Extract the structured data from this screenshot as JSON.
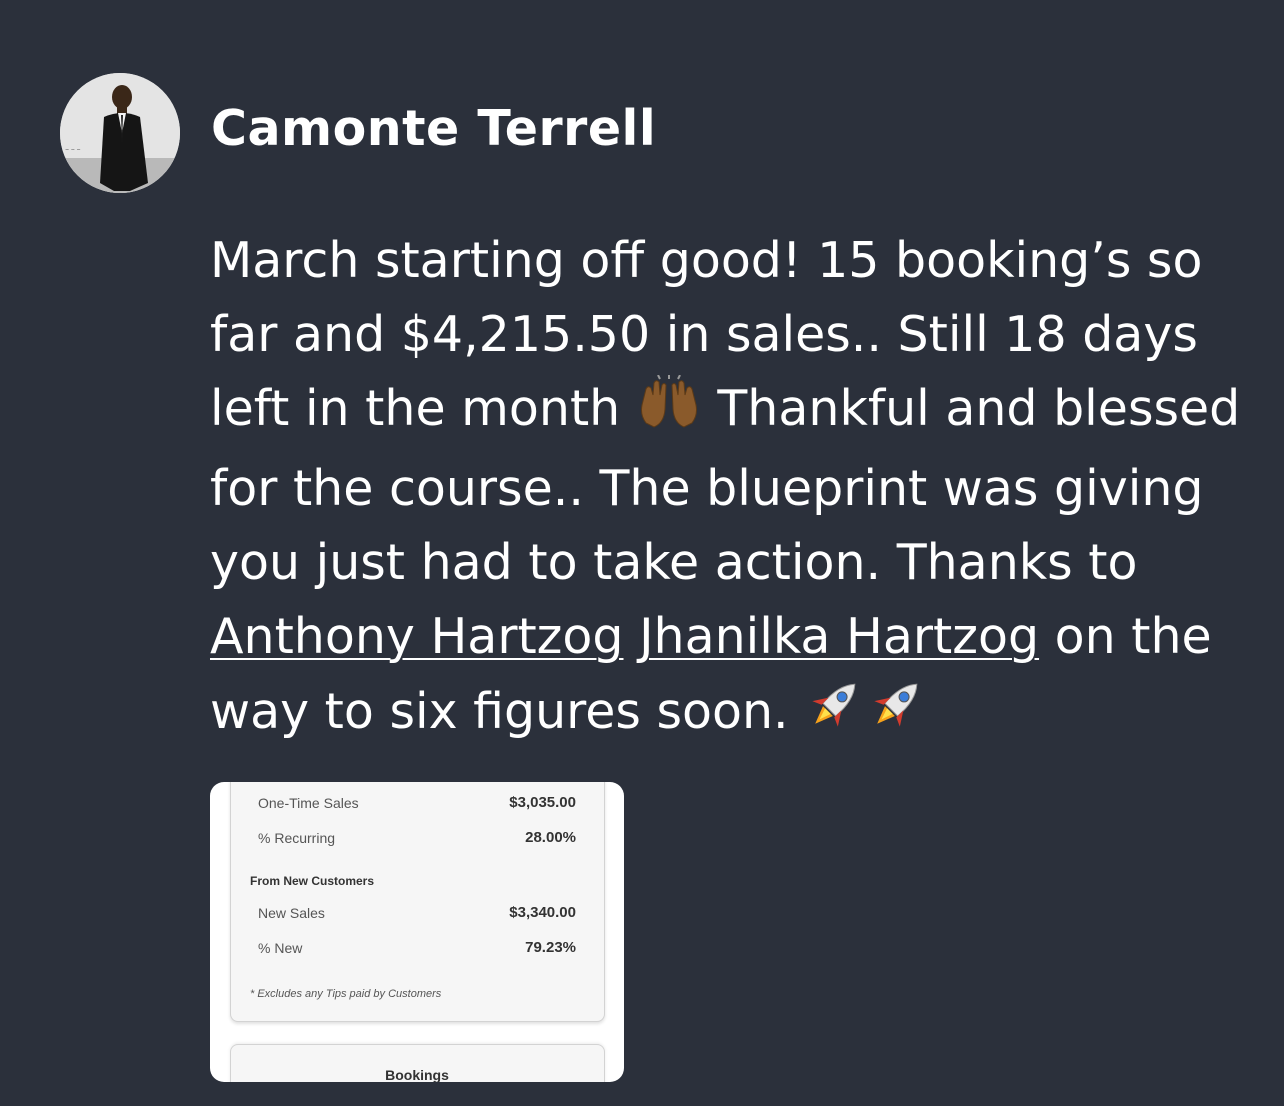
{
  "post": {
    "author": "Camonte Terrell",
    "text": {
      "line1": "March starting off good! 15 booking’s so",
      "line2": "far and $4,215.50 in sales.. Still 18 days",
      "line3a": "left in the month ",
      "line3b": " Thankful and blessed",
      "line4": "for the course.. The blueprint was giving",
      "line5": "you just had to take action. Thanks to",
      "line6_mention1": "Anthony Hartzog",
      "line6_mention2": "Jhanilka Hartzog",
      "line6_rest": " on the",
      "line7": "way to six figures soon. "
    },
    "emojis": [
      "raising-hands-emoji",
      "rocket-emoji",
      "rocket-emoji"
    ]
  },
  "attachment": {
    "rows": [
      {
        "label": "One-Time Sales",
        "value": "$3,035.00"
      },
      {
        "label": "% Recurring",
        "value": "28.00%"
      }
    ],
    "section_title": "From New Customers",
    "new_rows": [
      {
        "label": "New Sales",
        "value": "$3,340.00"
      },
      {
        "label": "% New",
        "value": "79.23%"
      }
    ],
    "footnote": "* Excludes any Tips paid by Customers",
    "next_section": "Bookings"
  },
  "colors": {
    "background": "#2b303b",
    "text": "#ffffff",
    "card": "#ffffff"
  }
}
